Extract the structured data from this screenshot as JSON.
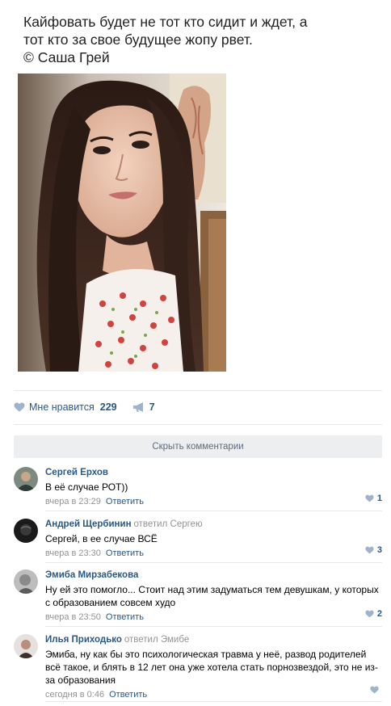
{
  "post": {
    "text": "Кайфовать будет не тот кто сидит и ждет, а\nтот кто за свое будущее жопу рвет.\n© Саша Грей"
  },
  "actions": {
    "like_label": "Мне нравится",
    "like_count": "229",
    "share_count": "7"
  },
  "hide_comments": "Скрыть комментарии",
  "comments": [
    {
      "author": "Сергей Ерхов",
      "reply_to": "",
      "text": "В её случае РОТ))",
      "time": "вчера в 23:29",
      "reply_label": "Ответить",
      "likes": "1"
    },
    {
      "author": "Андрей Щербинин",
      "reply_to": "ответил Сергею",
      "text": "Сергей, в ее случае ВСЁ",
      "time": "вчера в 23:30",
      "reply_label": "Ответить",
      "likes": "3"
    },
    {
      "author": "Эмиба Мирзабекова",
      "reply_to": "",
      "text": "Ну ей это помогло... Стоит над этим задуматься тем девушкам, у которых с образованием совсем худо",
      "time": "вчера в 23:50",
      "reply_label": "Ответить",
      "likes": "2"
    },
    {
      "author": "Илья Приходько",
      "reply_to": "ответил Эмибе",
      "text": "Эмиба, ну как бы это психологическая травма у неё, развод родителей всё такое, и блять в 12 лет она уже хотела стать порнозвездой, это не из-за образования",
      "time": "сегодня в 0:46",
      "reply_label": "Ответить",
      "likes": ""
    }
  ],
  "colors": {
    "link": "#2a5885",
    "muted": "#939393",
    "separator": "#e7e8ec",
    "hide_bar": "#edeef0",
    "icon": "#9fb3ca"
  }
}
